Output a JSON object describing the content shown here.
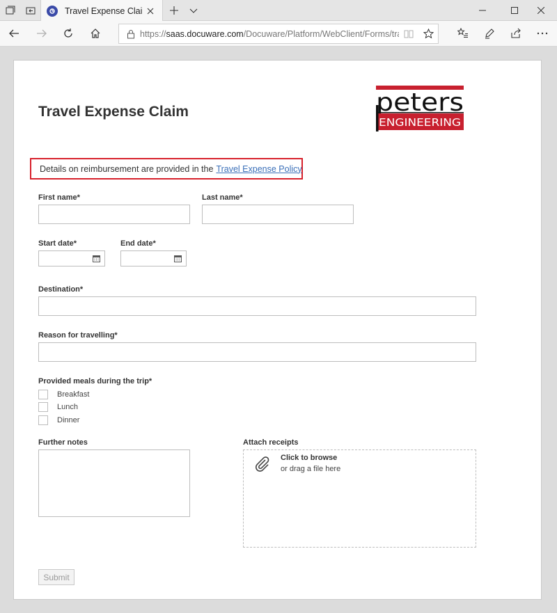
{
  "browser": {
    "tab_title": "Travel Expense Claim",
    "url_prefix": "https://",
    "url_host": "saas.docuware.com",
    "url_path": "/Docuware/Platform/WebClient/Forms/trave"
  },
  "form": {
    "title": "Travel Expense Claim",
    "logo": {
      "line1": "peters",
      "line2": "ENGINEERING",
      "color": "#c8202f"
    },
    "notice_text": "Details on reimbursement are provided in the",
    "notice_link": "Travel Expense Policy",
    "first_name_label": "First name*",
    "last_name_label": "Last name*",
    "start_date_label": "Start date*",
    "end_date_label": "End date*",
    "destination_label": "Destination*",
    "reason_label": "Reason for travelling*",
    "meals_label": "Provided meals during the trip*",
    "meals": [
      "Breakfast",
      "Lunch",
      "Dinner"
    ],
    "notes_label": "Further notes",
    "attach_label": "Attach receipts",
    "attach_main": "Click to browse",
    "attach_sub": "or drag a file here",
    "submit_label": "Submit"
  },
  "colors": {
    "notice_border": "#d7202b",
    "link": "#3a6fb8"
  }
}
